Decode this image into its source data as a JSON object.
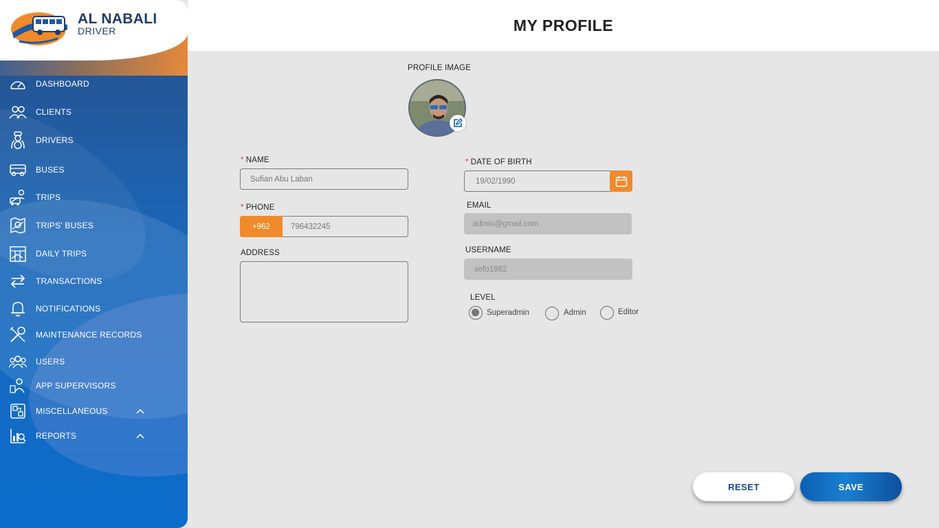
{
  "brand": {
    "title": "AL NABALI",
    "subtitle": "DRIVER"
  },
  "sidebar": {
    "items": [
      {
        "label": "DASHBOARD",
        "icon": "speedometer-icon"
      },
      {
        "label": "CLIENTS",
        "icon": "clients-icon"
      },
      {
        "label": "DRIVERS",
        "icon": "driver-icon"
      },
      {
        "label": "BUSES",
        "icon": "bus-icon"
      },
      {
        "label": "TRIPS",
        "icon": "trips-icon"
      },
      {
        "label": "TRIPS' BUSES",
        "icon": "trips-buses-icon"
      },
      {
        "label": "DAILY TRIPS",
        "icon": "daily-trips-icon"
      },
      {
        "label": "TRANSACTIONS",
        "icon": "transactions-icon"
      },
      {
        "label": "NOTIFICATIONS",
        "icon": "bell-icon"
      },
      {
        "label": "MAINTENANCE RECORDS",
        "icon": "tools-icon"
      },
      {
        "label": "USERS",
        "icon": "users-icon"
      },
      {
        "label": "APP SUPERVISORS",
        "icon": "supervisors-icon"
      },
      {
        "label": "MISCELLANEOUS",
        "icon": "miscellaneous-icon"
      },
      {
        "label": "REPORTS",
        "icon": "reports-icon"
      }
    ]
  },
  "header": {
    "title": "MY PROFILE"
  },
  "form": {
    "profile_image_label": "PROFILE IMAGE",
    "name": {
      "label": "NAME",
      "value": "Sufian Abu Laban"
    },
    "dob": {
      "label": "DATE OF BIRTH",
      "value": "19/02/1990"
    },
    "phone": {
      "label": "PHONE",
      "code": "+962",
      "value": "796432245"
    },
    "email": {
      "label": "EMAIL",
      "value": "admin@gmail.com"
    },
    "address": {
      "label": "ADDRESS",
      "value": ""
    },
    "username": {
      "label": "USERNAME",
      "value": "sefo1982"
    },
    "level": {
      "label": "LEVEL",
      "options": [
        "Superadmin",
        "Admin",
        "Editor"
      ],
      "selected": "Superadmin"
    },
    "required_mark": "*"
  },
  "actions": {
    "reset_label": "RESET",
    "save_label": "SAVE"
  },
  "colors": {
    "accent": "#f08a2a",
    "primary": "#0d5fb3",
    "required": "#e0382c"
  }
}
